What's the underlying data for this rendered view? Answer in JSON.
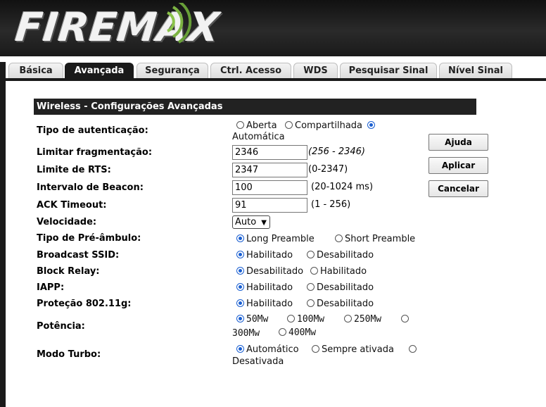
{
  "brand": {
    "logo_text": "FIREMAX"
  },
  "tabs": [
    {
      "label": "Básica",
      "active": false
    },
    {
      "label": "Avançada",
      "active": true
    },
    {
      "label": "Segurança",
      "active": false
    },
    {
      "label": "Ctrl. Acesso",
      "active": false
    },
    {
      "label": "WDS",
      "active": false
    },
    {
      "label": "Pesquisar Sinal",
      "active": false
    },
    {
      "label": "Nível Sinal",
      "active": false
    }
  ],
  "section": {
    "title": "Wireless - Configurações Avançadas"
  },
  "fields": {
    "auth": {
      "label": "Tipo de autenticação:",
      "options": [
        "Aberta",
        "Compartilhada",
        "Automática"
      ],
      "selected": "Automática"
    },
    "frag": {
      "label": "Limitar fragmentação:",
      "value": "2346",
      "hint": "(256 - 2346)"
    },
    "rts": {
      "label": "Limite de RTS:",
      "value": "2347",
      "hint": "(0-2347)"
    },
    "beacon": {
      "label": "Intervalo de Beacon:",
      "value": "100",
      "hint": "(20-1024 ms)"
    },
    "ack": {
      "label": "ACK Timeout:",
      "value": "91",
      "hint": "(1 - 256)"
    },
    "speed": {
      "label": "Velocidade:",
      "selected": "Auto"
    },
    "preamble": {
      "label": "Tipo de Pré-âmbulo:",
      "options": [
        "Long Preamble",
        "Short Preamble"
      ],
      "selected": "Long Preamble"
    },
    "ssid": {
      "label": "Broadcast SSID:",
      "options": [
        "Habilitado",
        "Desabilitado"
      ],
      "selected": "Habilitado"
    },
    "relay": {
      "label": "Block Relay:",
      "options": [
        "Desabilitado",
        "Habilitado"
      ],
      "selected": "Desabilitado"
    },
    "iapp": {
      "label": "IAPP:",
      "options": [
        "Habilitado",
        "Desabilitado"
      ],
      "selected": "Habilitado"
    },
    "prot": {
      "label": "Proteção 802.11g:",
      "options": [
        "Habilitado",
        "Desabilitado"
      ],
      "selected": "Habilitado"
    },
    "power": {
      "label": "Potência:",
      "options": [
        "50Mw",
        "100Mw",
        "250Mw",
        "300Mw",
        "400Mw"
      ],
      "selected": "50Mw"
    },
    "turbo": {
      "label": "Modo Turbo:",
      "options": [
        "Automático",
        "Sempre ativada",
        "Desativada"
      ],
      "selected": "Automático"
    }
  },
  "buttons": {
    "help": "Ajuda",
    "apply": "Aplicar",
    "cancel": "Cancelar"
  },
  "colors": {
    "header_bg": "#1a1a1a",
    "active_tab": "#1a1a1a",
    "radio_checked": "#1a5fd1"
  }
}
